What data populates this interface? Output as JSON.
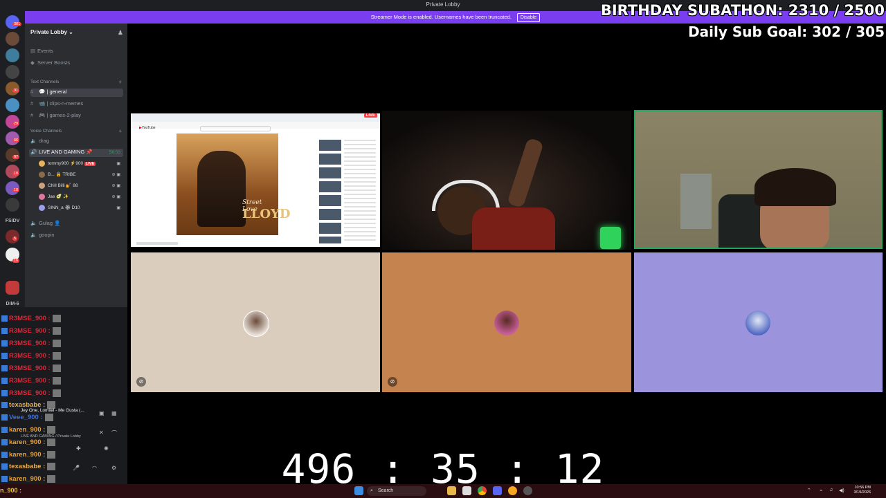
{
  "window": {
    "title": "Private Lobby"
  },
  "banner": {
    "text": "Streamer Mode is enabled. Usernames have been truncated.",
    "button": "Disable"
  },
  "overlay": {
    "subathon": "BIRTHDAY SUBATHON:  2310 / 2500",
    "daily_goal": "Daily Sub Goal:  302 / 305"
  },
  "guilds": {
    "badges": [
      "381",
      "31",
      "29",
      "66",
      "97",
      "18",
      "18",
      "5",
      "16"
    ],
    "folder_label": "FSIDV",
    "dm_label": "DIM-6"
  },
  "server": {
    "name": "Private Lobby",
    "chevron": "chevron-down-icon",
    "links": [
      {
        "label": "Events",
        "icon": "calendar-icon"
      },
      {
        "label": "Server Boosts",
        "icon": "boost-icon"
      }
    ],
    "text_category": "Text Channels",
    "text_channels": [
      {
        "label": "💬 | general"
      },
      {
        "label": "📹 | clips-n-memes"
      },
      {
        "label": "🎮 | games-2-play"
      }
    ],
    "voice_category": "Voice Channels",
    "voice_channels": [
      {
        "label": "drag"
      },
      {
        "label": "LIVE AND GAMING 📌",
        "timer": "56:03"
      },
      {
        "label": "Gulag 👤"
      },
      {
        "label": "goopin"
      }
    ],
    "voice_users": [
      {
        "name": "tommy900 ⚡900",
        "live": "LIVE",
        "color": "#e6b35a"
      },
      {
        "name": "B... 🔒 TRIBE",
        "color": "#8a6b4a"
      },
      {
        "name": "Chill Billi 💅 88",
        "color": "#c9a27c"
      },
      {
        "name": "Jae 🥑 ✨",
        "color": "#e0779b"
      },
      {
        "name": "SINN_a 🏵 D10",
        "color": "#9b9fe8"
      }
    ]
  },
  "chat": {
    "lines": [
      {
        "user": "R3MSE_900",
        "color": "#d42a3c"
      },
      {
        "user": "R3MSE_900",
        "color": "#d42a3c"
      },
      {
        "user": "R3MSE_900",
        "color": "#d42a3c"
      },
      {
        "user": "R3MSE_900",
        "color": "#d42a3c"
      },
      {
        "user": "R3MSE_900",
        "color": "#d42a3c"
      },
      {
        "user": "R3MSE_900",
        "color": "#d42a3c"
      },
      {
        "user": "R3MSE_900",
        "color": "#d42a3c"
      },
      {
        "user": "texasbabe",
        "color": "#e8b04a"
      },
      {
        "user": "Veee_900",
        "color": "#3b6fe0"
      },
      {
        "user": "karen_900",
        "color": "#e8a23a"
      },
      {
        "user": "karen_900",
        "color": "#e8a23a"
      },
      {
        "user": "karen_900",
        "color": "#e8a23a"
      },
      {
        "user": "texasbabe",
        "color": "#e8b04a"
      },
      {
        "user": "karen_900",
        "color": "#e8a23a"
      }
    ],
    "now_playing": "Jey One, Lomiiel - Me Gusta (...",
    "voice_status": "LIVE AND GAMING / Private Lobby",
    "bottom_user": "n_900 :"
  },
  "stage": {
    "screen_share": {
      "live": "LIVE",
      "site": "YouTube",
      "album_text": "Street Love",
      "album_logo": "LLOYD"
    },
    "tiles": [
      {
        "name": "tile-screen-share"
      },
      {
        "name": "tile-camera-1"
      },
      {
        "name": "tile-camera-2-speaking"
      },
      {
        "name": "tile-avatar-1",
        "bg": "#dbcdbd"
      },
      {
        "name": "tile-avatar-2",
        "bg": "#c4834f"
      },
      {
        "name": "tile-avatar-3",
        "bg": "#9b94dc"
      }
    ]
  },
  "timer": {
    "value": "496 : 35 : 12"
  },
  "taskbar": {
    "search": "Search",
    "time": "10:56 PM",
    "date": "3/19/2026"
  },
  "colors": {
    "discord_accent": "#7a3df0",
    "speaking": "#23a55a",
    "live": "#f23f43"
  }
}
